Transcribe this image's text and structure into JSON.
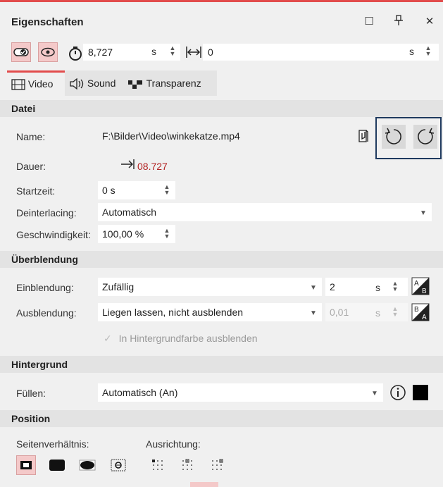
{
  "window": {
    "title": "Eigenschaften",
    "restore_icon": "restore-icon",
    "pin_icon": "pin-icon",
    "close_icon": "close-icon"
  },
  "toolbar": {
    "duration_value": "8,727",
    "duration_unit": "s",
    "offset_value": "0",
    "offset_unit": "s"
  },
  "tabs": [
    {
      "label": "Video",
      "icon": "film-icon"
    },
    {
      "label": "Sound",
      "icon": "speaker-icon"
    },
    {
      "label": "Transparenz",
      "icon": "transparency-icon"
    }
  ],
  "datei": {
    "header": "Datei",
    "name_label": "Name:",
    "name_value": "F:\\Bilder\\Video\\winkekatze.mp4",
    "dauer_label": "Dauer:",
    "dauer_value": "08.727",
    "startzeit_label": "Startzeit:",
    "startzeit_value": "0 s",
    "deinterlacing_label": "Deinterlacing:",
    "deinterlacing_value": "Automatisch",
    "speed_label": "Geschwindigkeit:",
    "speed_value": "100,00 %"
  },
  "ueberblendung": {
    "header": "Überblendung",
    "ein_label": "Einblendung:",
    "ein_value": "Zufällig",
    "ein_time": "2",
    "ein_unit": "s",
    "aus_label": "Ausblendung:",
    "aus_value": "Liegen lassen, nicht ausblenden",
    "aus_time": "0,01",
    "aus_unit": "s",
    "checkbox_label": "In Hintergrundfarbe ausblenden"
  },
  "hintergrund": {
    "header": "Hintergrund",
    "fuellen_label": "Füllen:",
    "fuellen_value": "Automatisch (An)"
  },
  "position": {
    "header": "Position",
    "seiten_label": "Seitenverhältnis:",
    "ausrichtung_label": "Ausrichtung:"
  },
  "colors": {
    "accent": "#e24c4c",
    "dauer_text": "#b22222",
    "highlight": "#1f3a5f"
  }
}
